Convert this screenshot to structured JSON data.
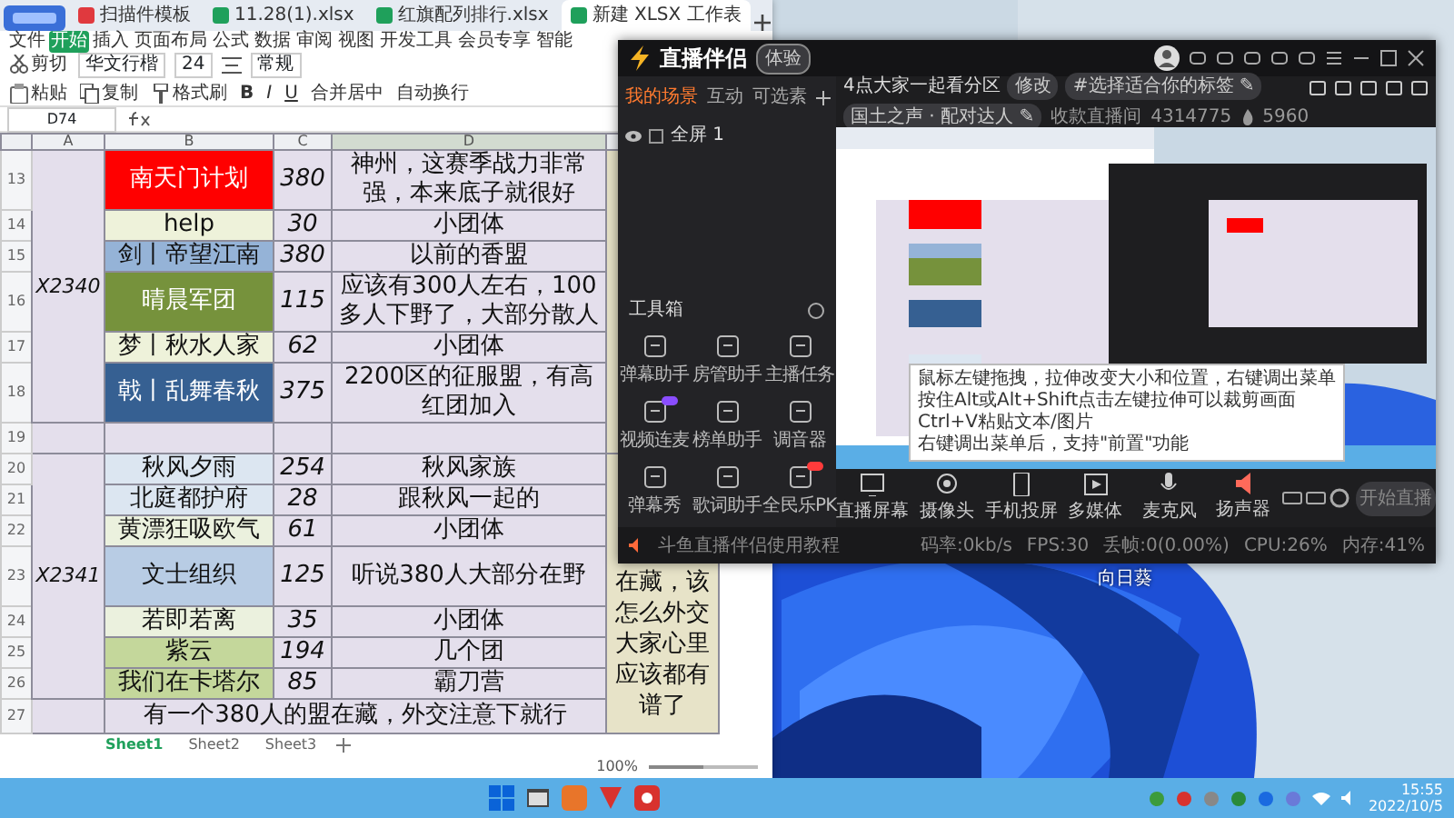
{
  "spreadsheet": {
    "tabs": [
      {
        "label": "扫描件模板",
        "kind": "pdf",
        "selected": false
      },
      {
        "label": "11.28(1).xlsx",
        "kind": "xlsx",
        "selected": false
      },
      {
        "label": "红旗配列排行.xlsx",
        "kind": "xlsx",
        "selected": false
      },
      {
        "label": "新建 XLSX 工作表",
        "kind": "xlsx",
        "selected": true
      }
    ],
    "menu": [
      {
        "label": "文件",
        "selected": false
      },
      {
        "label": "开始",
        "selected": true
      },
      {
        "label": "插入",
        "selected": false
      },
      {
        "label": "页面布局",
        "selected": false
      },
      {
        "label": "公式",
        "selected": false
      },
      {
        "label": "数据",
        "selected": false
      },
      {
        "label": "审阅",
        "selected": false
      },
      {
        "label": "视图",
        "selected": false
      },
      {
        "label": "开发工具",
        "selected": false
      },
      {
        "label": "会员专享",
        "selected": false
      },
      {
        "label": "智能",
        "selected": false
      }
    ],
    "clipboard": [
      {
        "kind": "cut",
        "label": "剪切"
      },
      {
        "kind": "paste",
        "label": "粘贴"
      },
      {
        "kind": "copy",
        "label": "复制"
      },
      {
        "kind": "painter",
        "label": "格式刷"
      }
    ],
    "font_name": "华文行楷",
    "font_size": "24",
    "styles": [
      "B",
      "I",
      "U"
    ],
    "merge_label": "合并居中",
    "wrap_label": "自动换行",
    "number_format": "常规",
    "cell_ref": "D74",
    "columns": [
      {
        "label": "A",
        "selected": false
      },
      {
        "label": "B",
        "selected": false
      },
      {
        "label": "C",
        "selected": false
      },
      {
        "label": "D",
        "selected": true
      }
    ],
    "blocks": [
      {
        "kind": "group",
        "server": "X2340",
        "rows": [
          {
            "num": "13",
            "name": "南天门计划",
            "color": "#ff0000",
            "count": "380",
            "note": "神州，这赛季战力非常强，本来底子就很好"
          },
          {
            "num": "14",
            "name": "help",
            "color": "#eef2da",
            "count": "30",
            "note": "小团体"
          },
          {
            "num": "15",
            "name": "剑丨帝望江南",
            "color": "#95b3d7",
            "count": "380",
            "note": "以前的香盟"
          },
          {
            "num": "16",
            "name": "晴晨军团",
            "color": "#76923c",
            "count": "115",
            "note": "应该有300人左右，100多人下野了，大部分散人"
          },
          {
            "num": "17",
            "name": "梦丨秋水人家",
            "color": "#eef2da",
            "count": "62",
            "note": "小团体"
          },
          {
            "num": "18",
            "name": "戟丨乱舞春秋",
            "color": "#366092",
            "count": "375",
            "note": "2200区的征服盟，有高红团加入"
          }
        ]
      },
      {
        "kind": "blank",
        "num": "19"
      },
      {
        "kind": "group",
        "server": "X2341",
        "side_note": "在藏，该怎么外交大家心里应该都有谱了",
        "rows": [
          {
            "num": "20",
            "name": "秋风夕雨",
            "color": "#dce6f1",
            "count": "254",
            "note": "秋风家族"
          },
          {
            "num": "21",
            "name": "北庭都护府",
            "color": "#dce6f1",
            "count": "28",
            "note": "跟秋风一起的"
          },
          {
            "num": "22",
            "name": "黄漂狂吸欧气",
            "color": "#ebf1de",
            "count": "61",
            "note": "小团体"
          },
          {
            "num": "23",
            "name": "文士组织",
            "color": "#b8cce4",
            "count": "125",
            "note": "听说380人大部分在野"
          },
          {
            "num": "24",
            "name": "若即若离",
            "color": "#ebf1de",
            "count": "35",
            "note": "小团体"
          },
          {
            "num": "25",
            "name": "紫云",
            "color": "#c4d79b",
            "count": "194",
            "note": "几个团"
          },
          {
            "num": "26",
            "name": "我们在卡塔尔",
            "color": "#c4d79b",
            "count": "85",
            "note": "霸刀营"
          }
        ]
      },
      {
        "kind": "summary",
        "num": "27",
        "text": "有一个380人的盟在藏，外交注意下就行"
      }
    ],
    "sheets": [
      {
        "label": "Sheet1",
        "selected": true
      },
      {
        "label": "Sheet2",
        "selected": false
      },
      {
        "label": "Sheet3",
        "selected": false
      }
    ],
    "zoom": "100%",
    "zoom_slider": {
      "level": 0.5
    }
  },
  "stream_app": {
    "title": "直播伴侣",
    "badge": "体验",
    "scene_tabs": [
      {
        "label": "我的场景",
        "selected": true
      },
      {
        "label": "互动",
        "selected": false
      },
      {
        "label": "可选素",
        "selected": false
      }
    ],
    "sources": [
      {
        "label": "全屏 1",
        "visible": true
      }
    ],
    "toolbox_title": "工具箱",
    "tools": [
      {
        "label": "弹幕助手"
      },
      {
        "label": "房管助手"
      },
      {
        "label": "主播任务"
      },
      {
        "label": "视频连麦",
        "color": "#8a4dff"
      },
      {
        "label": "榜单助手"
      },
      {
        "label": "调音器"
      },
      {
        "label": "弹幕秀"
      },
      {
        "label": "歌词助手"
      },
      {
        "label": "全民乐PK",
        "color": "#ff3b3b"
      }
    ],
    "room_title": "4点大家一起看分区",
    "edit_label": "修改",
    "tag": "#选择适合你的标签 ✎",
    "category": "国土之声 · 配对达人 ✎",
    "room_label": "收款直播间",
    "room_id": "4314775",
    "heat": "5960",
    "tooltip": [
      "鼠标左键拖拽，拉伸改变大小和位置，右键调出菜单",
      "按住Alt或Alt+Shift点击左键拉伸可以裁剪画面",
      "Ctrl+V粘贴文本/图片",
      "右键调出菜单后，支持\"前置\"功能"
    ],
    "controls": [
      {
        "kind": "screen",
        "label": "直播屏幕"
      },
      {
        "kind": "camera",
        "label": "摄像头"
      },
      {
        "kind": "phone",
        "label": "手机投屏"
      },
      {
        "kind": "media",
        "label": "多媒体"
      },
      {
        "kind": "mic",
        "label": "麦克风"
      },
      {
        "kind": "speaker",
        "label": "扬声器"
      }
    ],
    "start_button": "开始直播",
    "tutorial": "斗鱼直播伴侣使用教程",
    "stats": [
      "码率:0kb/s",
      "FPS:30",
      "丢帧:0(0.00%)",
      "CPU:26%",
      "内存:41%"
    ]
  },
  "desktop_icons": [
    {
      "label": "向日葵"
    }
  ],
  "taskbar": {
    "time": "15:55",
    "date": "2022/10/5"
  }
}
